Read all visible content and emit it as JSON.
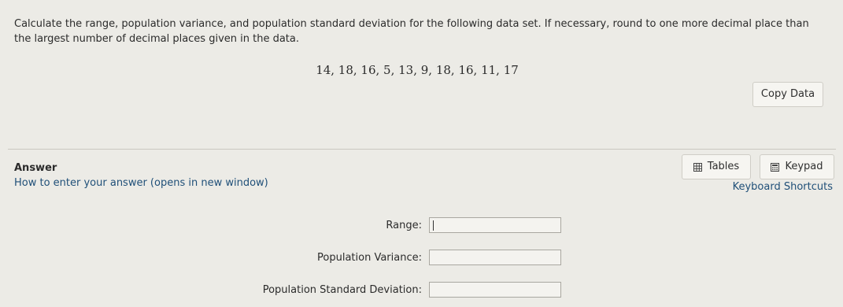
{
  "question": {
    "text": "Calculate the range, population variance, and population standard deviation for the following data set. If necessary, round to one more decimal place than the largest number of decimal places given in the data.",
    "dataset": "14, 18, 16, 5, 13, 9, 18, 16, 11, 17",
    "copy_button": "Copy Data"
  },
  "answer": {
    "heading": "Answer",
    "how_to_link": "How to enter your answer (opens in new window)",
    "keyboard_shortcuts": "Keyboard Shortcuts",
    "tables_button": "Tables",
    "keypad_button": "Keypad",
    "tables_icon": "table-icon",
    "keypad_icon": "calculator-icon",
    "fields": [
      {
        "label": "Range:",
        "value": ""
      },
      {
        "label": "Population Variance:",
        "value": ""
      },
      {
        "label": "Population Standard Deviation:",
        "value": ""
      }
    ]
  }
}
